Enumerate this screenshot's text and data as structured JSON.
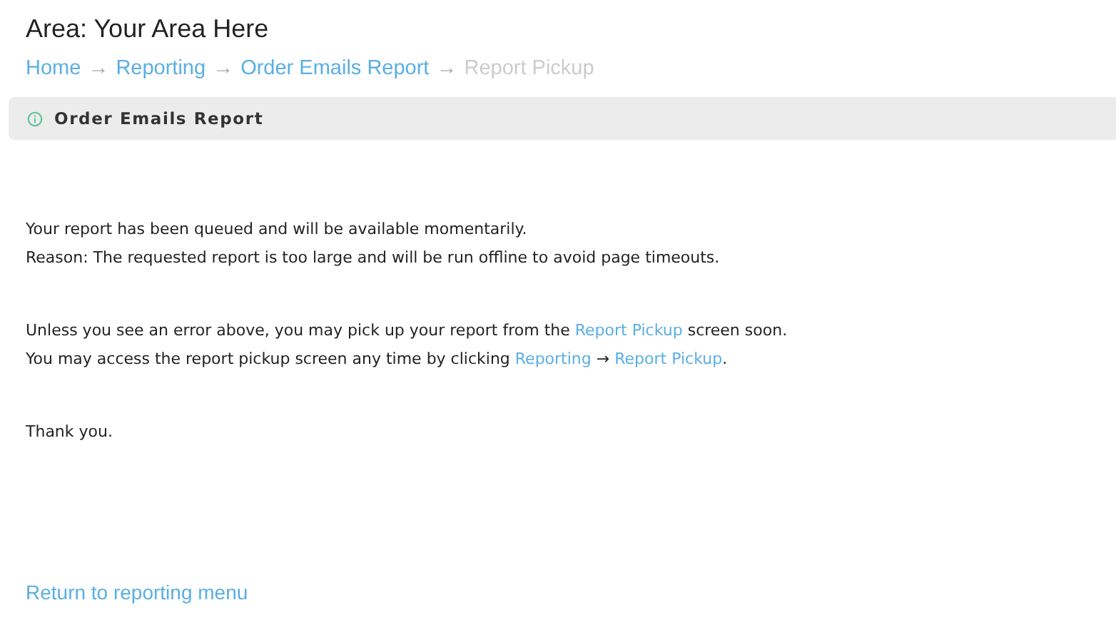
{
  "page": {
    "title": "Area: Your Area Here"
  },
  "breadcrumb": [
    {
      "kind": "link",
      "text": "Home"
    },
    {
      "kind": "separator",
      "text": "→"
    },
    {
      "kind": "link",
      "text": "Reporting"
    },
    {
      "kind": "separator",
      "text": "→"
    },
    {
      "kind": "link",
      "text": "Order Emails Report"
    },
    {
      "kind": "separator",
      "text": "→"
    },
    {
      "kind": "current",
      "text": "Report Pickup"
    }
  ],
  "panel": {
    "title": "Order Emails Report"
  },
  "paragraphs": [
    {
      "lines": [
        [
          {
            "kind": "text",
            "text": "Your report has been queued and will be available momentarily."
          }
        ],
        [
          {
            "kind": "text",
            "text": "Reason: The requested report is too large and will be run offline to avoid page timeouts."
          }
        ]
      ]
    },
    {
      "lines": [
        [
          {
            "kind": "text",
            "text": "Unless you see an error above, you may pick up your report from the "
          },
          {
            "kind": "link",
            "text": "Report Pickup"
          },
          {
            "kind": "text",
            "text": " screen soon."
          }
        ],
        [
          {
            "kind": "text",
            "text": "You may access the report pickup screen any time by clicking "
          },
          {
            "kind": "link",
            "text": "Reporting"
          },
          {
            "kind": "text",
            "text": "  → "
          },
          {
            "kind": "link",
            "text": "Report Pickup"
          },
          {
            "kind": "text",
            "text": "."
          }
        ]
      ]
    },
    {
      "lines": [
        [
          {
            "kind": "text",
            "text": "Thank you."
          }
        ]
      ]
    }
  ],
  "footer_link": "Return to reporting menu"
}
